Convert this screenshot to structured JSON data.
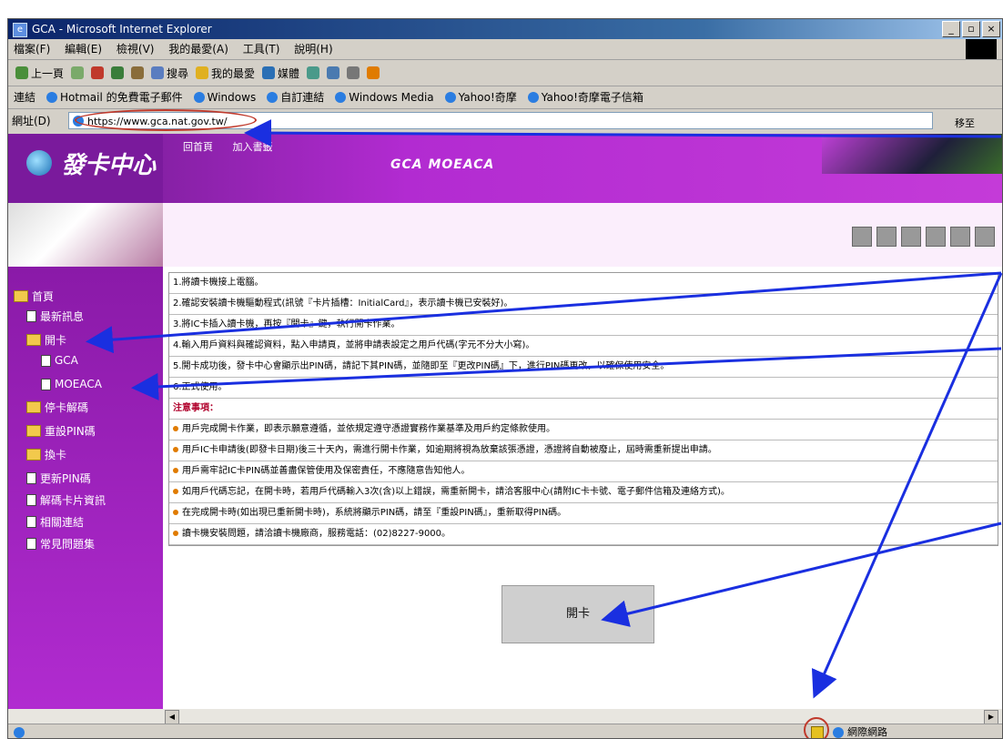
{
  "window": {
    "title": "GCA - Microsoft Internet Explorer",
    "buttons": [
      "_",
      "▫",
      "×"
    ]
  },
  "menubar": [
    "檔案(F)",
    "編輯(E)",
    "檢視(V)",
    "我的最愛(A)",
    "工具(T)",
    "說明(H)"
  ],
  "toolbar": [
    "上一頁",
    "搜尋",
    "我的最愛",
    "媒體"
  ],
  "links": {
    "label": "連結",
    "items": [
      "Hotmail 的免費電子郵件",
      "Windows",
      "自訂連結",
      "Windows Media",
      "Yahoo!奇摩",
      "Yahoo!奇摩電子信箱"
    ]
  },
  "address": {
    "label": "網址(D)",
    "value": "https://www.gca.nat.gov.tw/",
    "go": "移至"
  },
  "site": {
    "logo": "發卡中心",
    "toplinks": [
      "回首頁",
      "加入書籤"
    ],
    "brand": "GCA MOEACA"
  },
  "sidebar": [
    {
      "label": "首頁",
      "kind": "folder"
    },
    {
      "label": "最新訊息",
      "kind": "doc"
    },
    {
      "label": "開卡",
      "kind": "folder"
    },
    {
      "label": "GCA",
      "kind": "doc"
    },
    {
      "label": "MOEACA",
      "kind": "doc"
    },
    {
      "label": "停卡解碼",
      "kind": "folder"
    },
    {
      "label": "重設PIN碼",
      "kind": "folder"
    },
    {
      "label": "換卡",
      "kind": "folder"
    },
    {
      "label": "更新PIN碼",
      "kind": "doc"
    },
    {
      "label": "解碼卡片資訊",
      "kind": "doc"
    },
    {
      "label": "相關連結",
      "kind": "doc"
    },
    {
      "label": "常見問題集",
      "kind": "doc"
    }
  ],
  "instructions": [
    {
      "text": "1.將讀卡機接上電腦。",
      "type": "step"
    },
    {
      "text": "2.確認安裝讀卡機驅動程式(訊號『卡片插槽：InitialCard』，表示讀卡機已安裝好)。",
      "type": "step"
    },
    {
      "text": "3.將IC卡插入讀卡機，再按『開卡』鍵，執行開卡作業。",
      "type": "step"
    },
    {
      "text": "4.輸入用戶資料與確認資料，點入申請頁，並將申請表設定之用戶代碼(字元不分大小寫)。",
      "type": "step"
    },
    {
      "text": "5.開卡成功後，發卡中心會顯示出PIN碼，請記下其PIN碼，並隨即至『更改PIN碼』下，進行PIN碼更改，以確保使用安全。",
      "type": "step"
    },
    {
      "text": "6.正式使用。",
      "type": "step"
    },
    {
      "text": "注意事項：",
      "type": "note"
    },
    {
      "text": "用戶完成開卡作業，即表示願意遵循，並依規定遵守憑證實務作業基準及用戶約定條款使用。",
      "type": "bullet"
    },
    {
      "text": "用戶IC卡申請後(即發卡日期)後三十天內，需進行開卡作業，如逾期將視為放棄該張憑證，憑證將自動被廢止，屆時需重新提出申請。",
      "type": "bullet"
    },
    {
      "text": "用戶需牢記IC卡PIN碼並善盡保管使用及保密責任，不應隨意告知他人。",
      "type": "bullet"
    },
    {
      "text": "如用戶代碼忘記，在開卡時，若用戶代碼輸入3次(含)以上錯誤，需重新開卡，請洽客服中心(請附IC卡卡號、電子郵件信箱及連絡方式)。",
      "type": "bullet"
    },
    {
      "text": "在完成開卡時(如出現已重新開卡時)，系統將顯示PIN碼，請至『重設PIN碼』，重新取得PIN碼。",
      "type": "bullet"
    },
    {
      "text": "讀卡機安裝問題，請洽讀卡機廠商，服務電話：(02)8227-9000。",
      "type": "bullet"
    }
  ],
  "action_button": "開卡",
  "status": {
    "zone": "網際網路"
  }
}
